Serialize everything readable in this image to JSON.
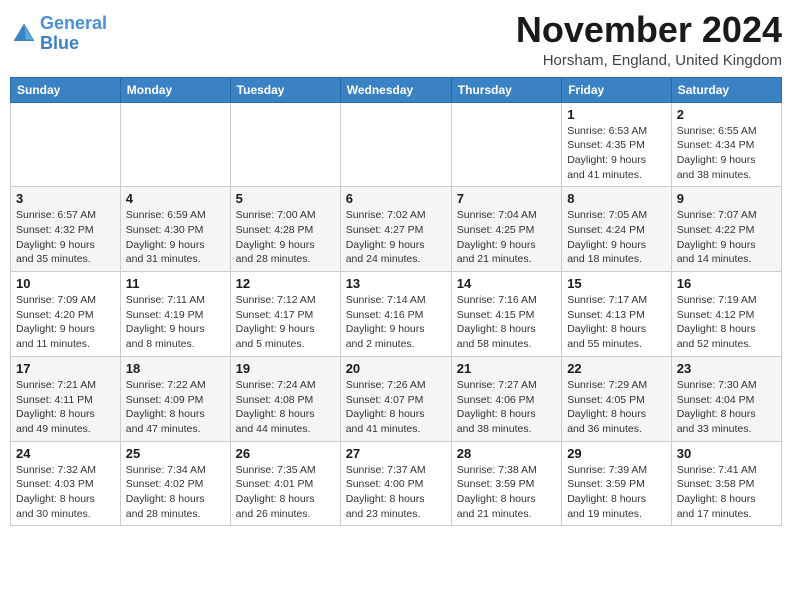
{
  "header": {
    "logo_line1": "General",
    "logo_line2": "Blue",
    "month": "November 2024",
    "location": "Horsham, England, United Kingdom"
  },
  "days_of_week": [
    "Sunday",
    "Monday",
    "Tuesday",
    "Wednesday",
    "Thursday",
    "Friday",
    "Saturday"
  ],
  "weeks": [
    {
      "alt": false,
      "days": [
        {
          "num": "",
          "info": ""
        },
        {
          "num": "",
          "info": ""
        },
        {
          "num": "",
          "info": ""
        },
        {
          "num": "",
          "info": ""
        },
        {
          "num": "",
          "info": ""
        },
        {
          "num": "1",
          "info": "Sunrise: 6:53 AM\nSunset: 4:35 PM\nDaylight: 9 hours\nand 41 minutes."
        },
        {
          "num": "2",
          "info": "Sunrise: 6:55 AM\nSunset: 4:34 PM\nDaylight: 9 hours\nand 38 minutes."
        }
      ]
    },
    {
      "alt": true,
      "days": [
        {
          "num": "3",
          "info": "Sunrise: 6:57 AM\nSunset: 4:32 PM\nDaylight: 9 hours\nand 35 minutes."
        },
        {
          "num": "4",
          "info": "Sunrise: 6:59 AM\nSunset: 4:30 PM\nDaylight: 9 hours\nand 31 minutes."
        },
        {
          "num": "5",
          "info": "Sunrise: 7:00 AM\nSunset: 4:28 PM\nDaylight: 9 hours\nand 28 minutes."
        },
        {
          "num": "6",
          "info": "Sunrise: 7:02 AM\nSunset: 4:27 PM\nDaylight: 9 hours\nand 24 minutes."
        },
        {
          "num": "7",
          "info": "Sunrise: 7:04 AM\nSunset: 4:25 PM\nDaylight: 9 hours\nand 21 minutes."
        },
        {
          "num": "8",
          "info": "Sunrise: 7:05 AM\nSunset: 4:24 PM\nDaylight: 9 hours\nand 18 minutes."
        },
        {
          "num": "9",
          "info": "Sunrise: 7:07 AM\nSunset: 4:22 PM\nDaylight: 9 hours\nand 14 minutes."
        }
      ]
    },
    {
      "alt": false,
      "days": [
        {
          "num": "10",
          "info": "Sunrise: 7:09 AM\nSunset: 4:20 PM\nDaylight: 9 hours\nand 11 minutes."
        },
        {
          "num": "11",
          "info": "Sunrise: 7:11 AM\nSunset: 4:19 PM\nDaylight: 9 hours\nand 8 minutes."
        },
        {
          "num": "12",
          "info": "Sunrise: 7:12 AM\nSunset: 4:17 PM\nDaylight: 9 hours\nand 5 minutes."
        },
        {
          "num": "13",
          "info": "Sunrise: 7:14 AM\nSunset: 4:16 PM\nDaylight: 9 hours\nand 2 minutes."
        },
        {
          "num": "14",
          "info": "Sunrise: 7:16 AM\nSunset: 4:15 PM\nDaylight: 8 hours\nand 58 minutes."
        },
        {
          "num": "15",
          "info": "Sunrise: 7:17 AM\nSunset: 4:13 PM\nDaylight: 8 hours\nand 55 minutes."
        },
        {
          "num": "16",
          "info": "Sunrise: 7:19 AM\nSunset: 4:12 PM\nDaylight: 8 hours\nand 52 minutes."
        }
      ]
    },
    {
      "alt": true,
      "days": [
        {
          "num": "17",
          "info": "Sunrise: 7:21 AM\nSunset: 4:11 PM\nDaylight: 8 hours\nand 49 minutes."
        },
        {
          "num": "18",
          "info": "Sunrise: 7:22 AM\nSunset: 4:09 PM\nDaylight: 8 hours\nand 47 minutes."
        },
        {
          "num": "19",
          "info": "Sunrise: 7:24 AM\nSunset: 4:08 PM\nDaylight: 8 hours\nand 44 minutes."
        },
        {
          "num": "20",
          "info": "Sunrise: 7:26 AM\nSunset: 4:07 PM\nDaylight: 8 hours\nand 41 minutes."
        },
        {
          "num": "21",
          "info": "Sunrise: 7:27 AM\nSunset: 4:06 PM\nDaylight: 8 hours\nand 38 minutes."
        },
        {
          "num": "22",
          "info": "Sunrise: 7:29 AM\nSunset: 4:05 PM\nDaylight: 8 hours\nand 36 minutes."
        },
        {
          "num": "23",
          "info": "Sunrise: 7:30 AM\nSunset: 4:04 PM\nDaylight: 8 hours\nand 33 minutes."
        }
      ]
    },
    {
      "alt": false,
      "days": [
        {
          "num": "24",
          "info": "Sunrise: 7:32 AM\nSunset: 4:03 PM\nDaylight: 8 hours\nand 30 minutes."
        },
        {
          "num": "25",
          "info": "Sunrise: 7:34 AM\nSunset: 4:02 PM\nDaylight: 8 hours\nand 28 minutes."
        },
        {
          "num": "26",
          "info": "Sunrise: 7:35 AM\nSunset: 4:01 PM\nDaylight: 8 hours\nand 26 minutes."
        },
        {
          "num": "27",
          "info": "Sunrise: 7:37 AM\nSunset: 4:00 PM\nDaylight: 8 hours\nand 23 minutes."
        },
        {
          "num": "28",
          "info": "Sunrise: 7:38 AM\nSunset: 3:59 PM\nDaylight: 8 hours\nand 21 minutes."
        },
        {
          "num": "29",
          "info": "Sunrise: 7:39 AM\nSunset: 3:59 PM\nDaylight: 8 hours\nand 19 minutes."
        },
        {
          "num": "30",
          "info": "Sunrise: 7:41 AM\nSunset: 3:58 PM\nDaylight: 8 hours\nand 17 minutes."
        }
      ]
    }
  ]
}
